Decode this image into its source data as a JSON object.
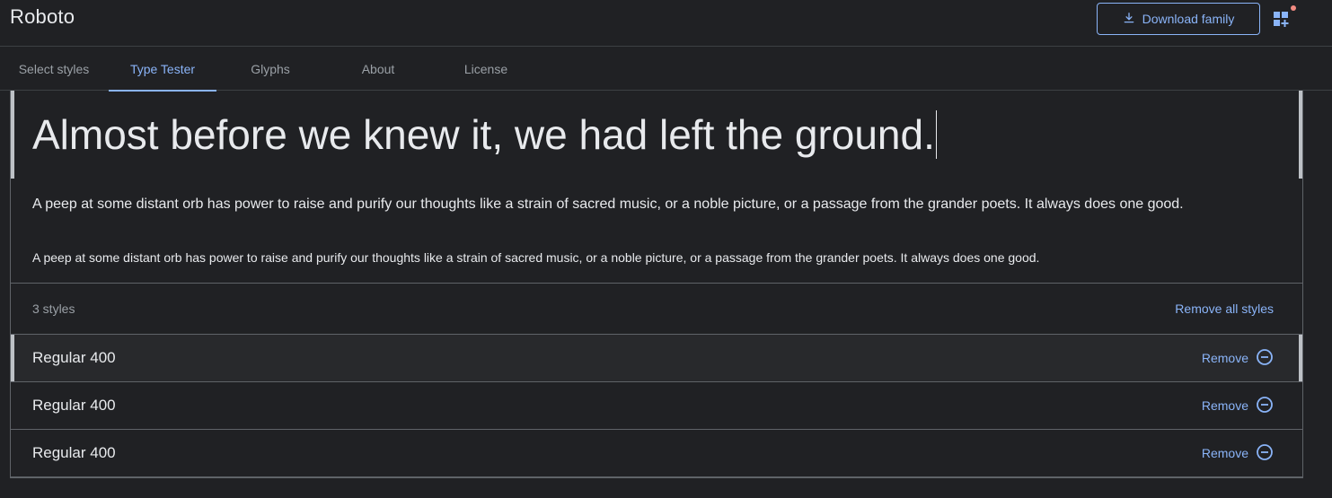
{
  "header": {
    "family_name": "Roboto",
    "download_label": "Download family"
  },
  "tabs": [
    {
      "label": "Select styles",
      "active": false
    },
    {
      "label": "Type Tester",
      "active": true
    },
    {
      "label": "Glyphs",
      "active": false
    },
    {
      "label": "About",
      "active": false
    },
    {
      "label": "License",
      "active": false
    }
  ],
  "tester": {
    "large_sample": "Almost before we knew it, we had left the ground.",
    "medium_sample": "A peep at some distant orb has power to raise and purify our thoughts like a strain of sacred music, or a noble picture, or a passage from the grander poets. It always does one good.",
    "small_sample": "A peep at some distant orb has power to raise and purify our thoughts like a strain of sacred music, or a noble picture, or a passage from the grander poets. It always does one good."
  },
  "styles": {
    "count_label": "3 styles",
    "remove_all_label": "Remove all styles",
    "items": [
      {
        "name": "Regular 400",
        "remove_label": "Remove"
      },
      {
        "name": "Regular 400",
        "remove_label": "Remove"
      },
      {
        "name": "Regular 400",
        "remove_label": "Remove"
      }
    ]
  },
  "colors": {
    "background": "#202124",
    "accent": "#8ab4f8",
    "notification": "#f28b82"
  },
  "icons": {
    "download": "download-icon",
    "collection": "selected-families-icon",
    "remove": "remove-circle-icon"
  }
}
